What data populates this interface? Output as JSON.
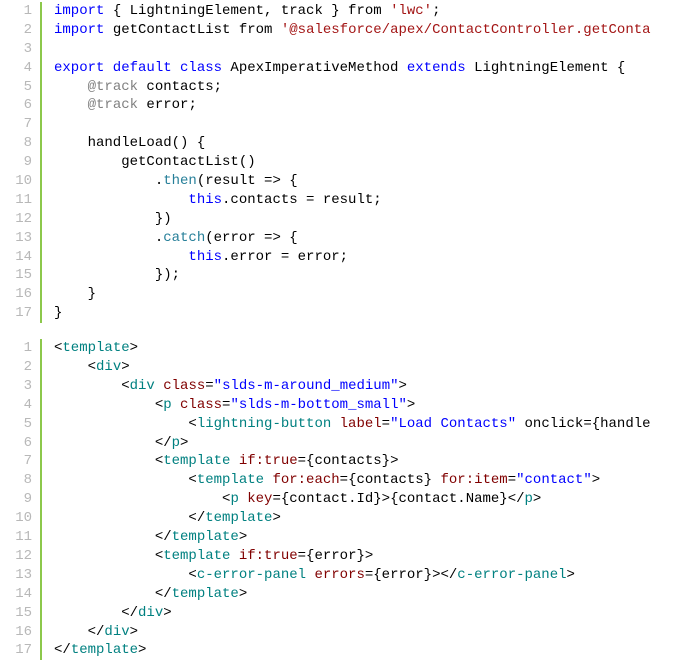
{
  "block1": {
    "lines": [
      {
        "n": "1",
        "html": "<span class='kw'>import</span> { LightningElement, track } from <span class='str'>'lwc'</span>;"
      },
      {
        "n": "2",
        "html": "<span class='kw'>import</span> getContactList from <span class='str'>'@salesforce/apex/ContactController.getConta</span>"
      },
      {
        "n": "3",
        "html": " "
      },
      {
        "n": "4",
        "html": "<span class='kw'>export default class</span> ApexImperativeMethod <span class='kw'>extends</span> LightningElement {"
      },
      {
        "n": "5",
        "html": "    <span class='at'>@track</span> contacts;"
      },
      {
        "n": "6",
        "html": "    <span class='at'>@track</span> error;"
      },
      {
        "n": "7",
        "html": " "
      },
      {
        "n": "8",
        "html": "    handleLoad() {"
      },
      {
        "n": "9",
        "html": "        getContactList()"
      },
      {
        "n": "10",
        "html": "            .<span class='method'>then</span>(result =&gt; {"
      },
      {
        "n": "11",
        "html": "                <span class='thiskw'>this</span>.contacts = result;"
      },
      {
        "n": "12",
        "html": "            })"
      },
      {
        "n": "13",
        "html": "            .<span class='method'>catch</span>(error =&gt; {"
      },
      {
        "n": "14",
        "html": "                <span class='thiskw'>this</span>.error = error;"
      },
      {
        "n": "15",
        "html": "            });"
      },
      {
        "n": "16",
        "html": "    }"
      },
      {
        "n": "17",
        "html": "}"
      }
    ]
  },
  "block2": {
    "lines": [
      {
        "n": "1",
        "html": "&lt;<span class='tag'>template</span>&gt;"
      },
      {
        "n": "2",
        "html": "    &lt;<span class='tag'>div</span>&gt;"
      },
      {
        "n": "3",
        "html": "        &lt;<span class='tag'>div</span> <span class='attr'>class</span>=<span class='attrval'>\"slds-m-around_medium\"</span>&gt;"
      },
      {
        "n": "4",
        "html": "            &lt;<span class='tag'>p</span> <span class='attr'>class</span>=<span class='attrval'>\"slds-m-bottom_small\"</span>&gt;"
      },
      {
        "n": "5",
        "html": "                &lt;<span class='tag'>lightning-button</span> <span class='attr'>label</span>=<span class='attrval'>\"Load Contacts\"</span> onclick={handle"
      },
      {
        "n": "6",
        "html": "            &lt;/<span class='tag'>p</span>&gt;"
      },
      {
        "n": "7",
        "html": "            &lt;<span class='tag'>template</span> <span class='attr'>if:true</span>={contacts}&gt;"
      },
      {
        "n": "8",
        "html": "                &lt;<span class='tag'>template</span> <span class='attr'>for:each</span>={contacts} <span class='attr'>for:item</span>=<span class='attrval'>\"contact\"</span>&gt;"
      },
      {
        "n": "9",
        "html": "                    &lt;<span class='tag'>p</span> <span class='attr'>key</span>={contact.Id}&gt;{contact.Name}&lt;/<span class='tag'>p</span>&gt;"
      },
      {
        "n": "10",
        "html": "                &lt;/<span class='tag'>template</span>&gt;"
      },
      {
        "n": "11",
        "html": "            &lt;/<span class='tag'>template</span>&gt;"
      },
      {
        "n": "12",
        "html": "            &lt;<span class='tag'>template</span> <span class='attr'>if:true</span>={error}&gt;"
      },
      {
        "n": "13",
        "html": "                &lt;<span class='tag'>c-error-panel</span> <span class='attr'>errors</span>={error}&gt;&lt;/<span class='tag'>c-error-panel</span>&gt;"
      },
      {
        "n": "14",
        "html": "            &lt;/<span class='tag'>template</span>&gt;"
      },
      {
        "n": "15",
        "html": "        &lt;/<span class='tag'>div</span>&gt;"
      },
      {
        "n": "16",
        "html": "    &lt;/<span class='tag'>div</span>&gt;"
      },
      {
        "n": "17",
        "html": "&lt;/<span class='tag'>template</span>&gt;"
      }
    ]
  }
}
